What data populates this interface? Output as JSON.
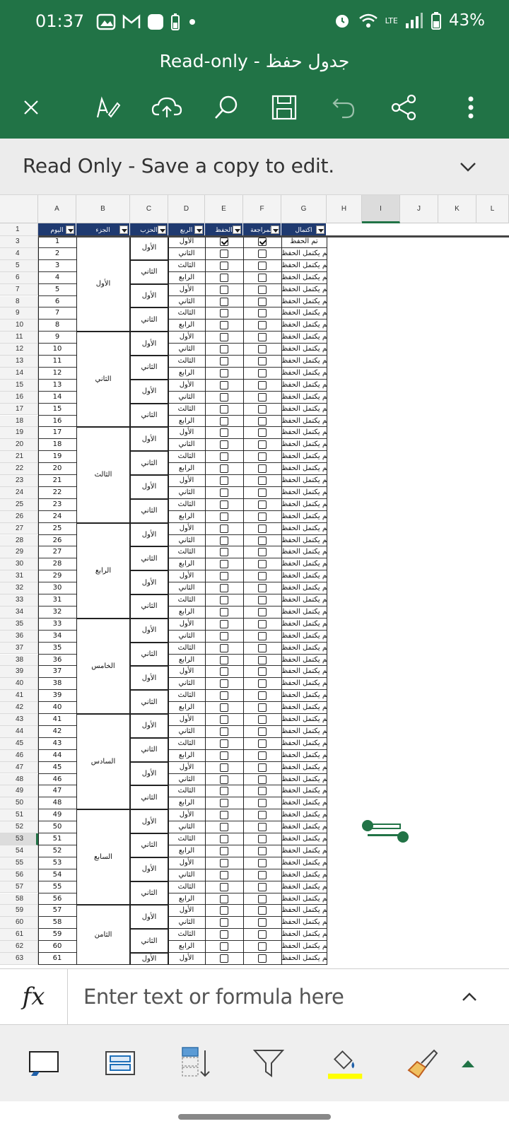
{
  "status_bar": {
    "time": "01:37",
    "battery": "43%",
    "network": "LTE"
  },
  "window": {
    "title": "Read-only - جدول حفظ"
  },
  "banner": {
    "message": "Read Only - Save a copy to edit."
  },
  "columns": [
    "A",
    "B",
    "C",
    "D",
    "E",
    "F",
    "G",
    "H",
    "I",
    "J",
    "K",
    "L"
  ],
  "table_header": {
    "A": "اليوم",
    "B": "الجزء",
    "C": "الحزب",
    "D": "الربع",
    "E": "الحفظ",
    "F": "المراجعة",
    "G": "اكتمال"
  },
  "rows": [
    {
      "r": "1"
    },
    {
      "r": "3",
      "day": "1",
      "rub": "الأول",
      "hifz": true,
      "rev": true,
      "status": "تم الحفظ"
    },
    {
      "r": "4",
      "day": "2",
      "rub": "الثاني",
      "hifz": false,
      "rev": false,
      "status": "لم يكتمل الحفظ"
    },
    {
      "r": "5",
      "day": "3",
      "rub": "الثالث",
      "hifz": false,
      "rev": false,
      "status": "لم يكتمل الحفظ"
    },
    {
      "r": "6",
      "day": "4",
      "rub": "الرابع",
      "hifz": false,
      "rev": false,
      "status": "لم يكتمل الحفظ"
    },
    {
      "r": "7",
      "day": "5",
      "rub": "الأول",
      "hifz": false,
      "rev": false,
      "status": "لم يكتمل الحفظ"
    },
    {
      "r": "8",
      "day": "6",
      "rub": "الثاني",
      "hifz": false,
      "rev": false,
      "status": "لم يكتمل الحفظ"
    },
    {
      "r": "9",
      "day": "7",
      "rub": "الثالث",
      "hifz": false,
      "rev": false,
      "status": "لم يكتمل الحفظ"
    },
    {
      "r": "10",
      "day": "8",
      "rub": "الرابع",
      "hifz": false,
      "rev": false,
      "status": "لم يكتمل الحفظ"
    },
    {
      "r": "11",
      "day": "9",
      "rub": "الأول",
      "hifz": false,
      "rev": false,
      "status": "لم يكتمل الحفظ"
    },
    {
      "r": "12",
      "day": "10",
      "rub": "الثاني",
      "hifz": false,
      "rev": false,
      "status": "لم يكتمل الحفظ"
    },
    {
      "r": "13",
      "day": "11",
      "rub": "الثالث",
      "hifz": false,
      "rev": false,
      "status": "لم يكتمل الحفظ"
    },
    {
      "r": "14",
      "day": "12",
      "rub": "الرابع",
      "hifz": false,
      "rev": false,
      "status": "لم يكتمل الحفظ"
    },
    {
      "r": "15",
      "day": "13",
      "rub": "الأول",
      "hifz": false,
      "rev": false,
      "status": "لم يكتمل الحفظ"
    },
    {
      "r": "16",
      "day": "14",
      "rub": "الثاني",
      "hifz": false,
      "rev": false,
      "status": "لم يكتمل الحفظ"
    },
    {
      "r": "17",
      "day": "15",
      "rub": "الثالث",
      "hifz": false,
      "rev": false,
      "status": "لم يكتمل الحفظ"
    },
    {
      "r": "18",
      "day": "16",
      "rub": "الرابع",
      "hifz": false,
      "rev": false,
      "status": "لم يكتمل الحفظ"
    },
    {
      "r": "19",
      "day": "17",
      "rub": "الأول",
      "hifz": false,
      "rev": false,
      "status": "لم يكتمل الحفظ"
    },
    {
      "r": "20",
      "day": "18",
      "rub": "الثاني",
      "hifz": false,
      "rev": false,
      "status": "لم يكتمل الحفظ"
    },
    {
      "r": "21",
      "day": "19",
      "rub": "الثالث",
      "hifz": false,
      "rev": false,
      "status": "لم يكتمل الحفظ"
    },
    {
      "r": "22",
      "day": "20",
      "rub": "الرابع",
      "hifz": false,
      "rev": false,
      "status": "لم يكتمل الحفظ"
    },
    {
      "r": "23",
      "day": "21",
      "rub": "الأول",
      "hifz": false,
      "rev": false,
      "status": "لم يكتمل الحفظ"
    },
    {
      "r": "24",
      "day": "22",
      "rub": "الثاني",
      "hifz": false,
      "rev": false,
      "status": "لم يكتمل الحفظ"
    },
    {
      "r": "25",
      "day": "23",
      "rub": "الثالث",
      "hifz": false,
      "rev": false,
      "status": "لم يكتمل الحفظ"
    },
    {
      "r": "26",
      "day": "24",
      "rub": "الرابع",
      "hifz": false,
      "rev": false,
      "status": "لم يكتمل الحفظ"
    },
    {
      "r": "27",
      "day": "25",
      "rub": "الأول",
      "hifz": false,
      "rev": false,
      "status": "لم يكتمل الحفظ"
    },
    {
      "r": "28",
      "day": "26",
      "rub": "الثاني",
      "hifz": false,
      "rev": false,
      "status": "لم يكتمل الحفظ"
    },
    {
      "r": "29",
      "day": "27",
      "rub": "الثالث",
      "hifz": false,
      "rev": false,
      "status": "لم يكتمل الحفظ"
    },
    {
      "r": "30",
      "day": "28",
      "rub": "الرابع",
      "hifz": false,
      "rev": false,
      "status": "لم يكتمل الحفظ"
    },
    {
      "r": "31",
      "day": "29",
      "rub": "الأول",
      "hifz": false,
      "rev": false,
      "status": "لم يكتمل الحفظ"
    },
    {
      "r": "32",
      "day": "30",
      "rub": "الثاني",
      "hifz": false,
      "rev": false,
      "status": "لم يكتمل الحفظ"
    },
    {
      "r": "33",
      "day": "31",
      "rub": "الثالث",
      "hifz": false,
      "rev": false,
      "status": "لم يكتمل الحفظ"
    },
    {
      "r": "34",
      "day": "32",
      "rub": "الرابع",
      "hifz": false,
      "rev": false,
      "status": "لم يكتمل الحفظ"
    },
    {
      "r": "35",
      "day": "33",
      "rub": "الأول",
      "hifz": false,
      "rev": false,
      "status": "لم يكتمل الحفظ"
    },
    {
      "r": "36",
      "day": "34",
      "rub": "الثاني",
      "hifz": false,
      "rev": false,
      "status": "لم يكتمل الحفظ"
    },
    {
      "r": "37",
      "day": "35",
      "rub": "الثالث",
      "hifz": false,
      "rev": false,
      "status": "لم يكتمل الحفظ"
    },
    {
      "r": "38",
      "day": "36",
      "rub": "الرابع",
      "hifz": false,
      "rev": false,
      "status": "لم يكتمل الحفظ"
    },
    {
      "r": "39",
      "day": "37",
      "rub": "الأول",
      "hifz": false,
      "rev": false,
      "status": "لم يكتمل الحفظ"
    },
    {
      "r": "40",
      "day": "38",
      "rub": "الثاني",
      "hifz": false,
      "rev": false,
      "status": "لم يكتمل الحفظ"
    },
    {
      "r": "41",
      "day": "39",
      "rub": "الثالث",
      "hifz": false,
      "rev": false,
      "status": "لم يكتمل الحفظ"
    },
    {
      "r": "42",
      "day": "40",
      "rub": "الرابع",
      "hifz": false,
      "rev": false,
      "status": "لم يكتمل الحفظ"
    },
    {
      "r": "43",
      "day": "41",
      "rub": "الأول",
      "hifz": false,
      "rev": false,
      "status": "لم يكتمل الحفظ"
    },
    {
      "r": "44",
      "day": "42",
      "rub": "الثاني",
      "hifz": false,
      "rev": false,
      "status": "لم يكتمل الحفظ"
    },
    {
      "r": "45",
      "day": "43",
      "rub": "الثالث",
      "hifz": false,
      "rev": false,
      "status": "لم يكتمل الحفظ"
    },
    {
      "r": "46",
      "day": "44",
      "rub": "الرابع",
      "hifz": false,
      "rev": false,
      "status": "لم يكتمل الحفظ"
    },
    {
      "r": "47",
      "day": "45",
      "rub": "الأول",
      "hifz": false,
      "rev": false,
      "status": "لم يكتمل الحفظ"
    },
    {
      "r": "48",
      "day": "46",
      "rub": "الثاني",
      "hifz": false,
      "rev": false,
      "status": "لم يكتمل الحفظ"
    },
    {
      "r": "49",
      "day": "47",
      "rub": "الثالث",
      "hifz": false,
      "rev": false,
      "status": "لم يكتمل الحفظ"
    },
    {
      "r": "50",
      "day": "48",
      "rub": "الرابع",
      "hifz": false,
      "rev": false,
      "status": "لم يكتمل الحفظ"
    },
    {
      "r": "51",
      "day": "49",
      "rub": "الأول",
      "hifz": false,
      "rev": false,
      "status": "لم يكتمل الحفظ"
    },
    {
      "r": "52",
      "day": "50",
      "rub": "الثاني",
      "hifz": false,
      "rev": false,
      "status": "لم يكتمل الحفظ"
    },
    {
      "r": "53",
      "day": "51",
      "rub": "الثالث",
      "hifz": false,
      "rev": false,
      "status": "لم يكتمل الحفظ"
    },
    {
      "r": "54",
      "day": "52",
      "rub": "الرابع",
      "hifz": false,
      "rev": false,
      "status": "لم يكتمل الحفظ"
    },
    {
      "r": "55",
      "day": "53",
      "rub": "الأول",
      "hifz": false,
      "rev": false,
      "status": "لم يكتمل الحفظ"
    },
    {
      "r": "56",
      "day": "54",
      "rub": "الثاني",
      "hifz": false,
      "rev": false,
      "status": "لم يكتمل الحفظ"
    },
    {
      "r": "57",
      "day": "55",
      "rub": "الثالث",
      "hifz": false,
      "rev": false,
      "status": "لم يكتمل الحفظ"
    },
    {
      "r": "58",
      "day": "56",
      "rub": "الرابع",
      "hifz": false,
      "rev": false,
      "status": "لم يكتمل الحفظ"
    },
    {
      "r": "59",
      "day": "57",
      "rub": "الأول",
      "hifz": false,
      "rev": false,
      "status": "لم يكتمل الحفظ"
    },
    {
      "r": "60",
      "day": "58",
      "rub": "الثاني",
      "hifz": false,
      "rev": false,
      "status": "لم يكتمل الحفظ"
    },
    {
      "r": "61",
      "day": "59",
      "rub": "الثالث",
      "hifz": false,
      "rev": false,
      "status": "لم يكتمل الحفظ"
    },
    {
      "r": "62",
      "day": "60",
      "rub": "الرابع",
      "hifz": false,
      "rev": false,
      "status": "لم يكتمل الحفظ"
    },
    {
      "r": "63",
      "day": "61",
      "rub": "الأول",
      "hifz": false,
      "rev": false,
      "status": "لم يكتمل الحفظ"
    }
  ],
  "juz_labels": [
    "الأول",
    "الثاني",
    "الثالث",
    "الرابع",
    "الخامس",
    "السادس",
    "السابع",
    "الثامن"
  ],
  "hizb_labels": [
    "الأول",
    "الثاني"
  ],
  "formula_bar": {
    "fx_label": "fx",
    "placeholder": "Enter text or formula here"
  },
  "colors": {
    "brand": "#217346",
    "header_fill": "#1f3a70",
    "highlight": "#ffff00"
  }
}
